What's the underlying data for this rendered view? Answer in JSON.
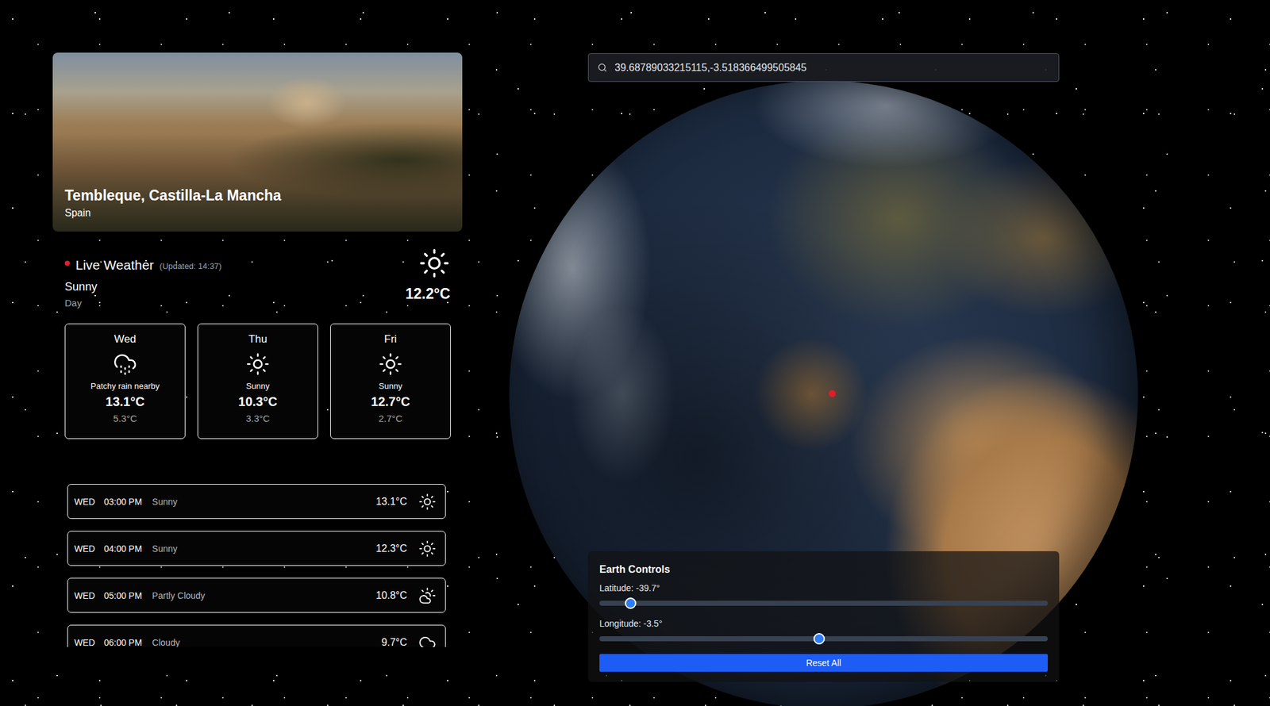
{
  "location": {
    "title": "Tembleque, Castilla-La Mancha",
    "country": "Spain"
  },
  "live": {
    "label": "Live Weather",
    "updated": "(Updated: 14:37)",
    "condition": "Sunny",
    "period": "Day",
    "temperature": "12.2°C",
    "kind": "sun"
  },
  "forecast": [
    {
      "day": "Wed",
      "condition": "Patchy rain nearby",
      "high": "13.1°C",
      "low": "5.3°C",
      "kind": "rain"
    },
    {
      "day": "Thu",
      "condition": "Sunny",
      "high": "10.3°C",
      "low": "3.3°C",
      "kind": "sun"
    },
    {
      "day": "Fri",
      "condition": "Sunny",
      "high": "12.7°C",
      "low": "2.7°C",
      "kind": "sun"
    }
  ],
  "hourly": [
    {
      "day": "WED",
      "time": "03:00 PM",
      "condition": "Sunny",
      "temperature": "13.1°C",
      "kind": "sun"
    },
    {
      "day": "WED",
      "time": "04:00 PM",
      "condition": "Sunny",
      "temperature": "12.3°C",
      "kind": "sun"
    },
    {
      "day": "WED",
      "time": "05:00 PM",
      "condition": "Partly Cloudy",
      "temperature": "10.8°C",
      "kind": "partly"
    },
    {
      "day": "WED",
      "time": "06:00 PM",
      "condition": "Cloudy",
      "temperature": "9.7°C",
      "kind": "cloud"
    }
  ],
  "search": {
    "value": "39.68789033215115,-3.518366499505845"
  },
  "controls": {
    "title": "Earth Controls",
    "sliders": [
      {
        "label": "Latitude: -39.7°",
        "level": 0.07
      },
      {
        "label": "Longitude: -3.5°",
        "level": 0.49
      }
    ],
    "buttons": [
      "Reset All"
    ]
  }
}
